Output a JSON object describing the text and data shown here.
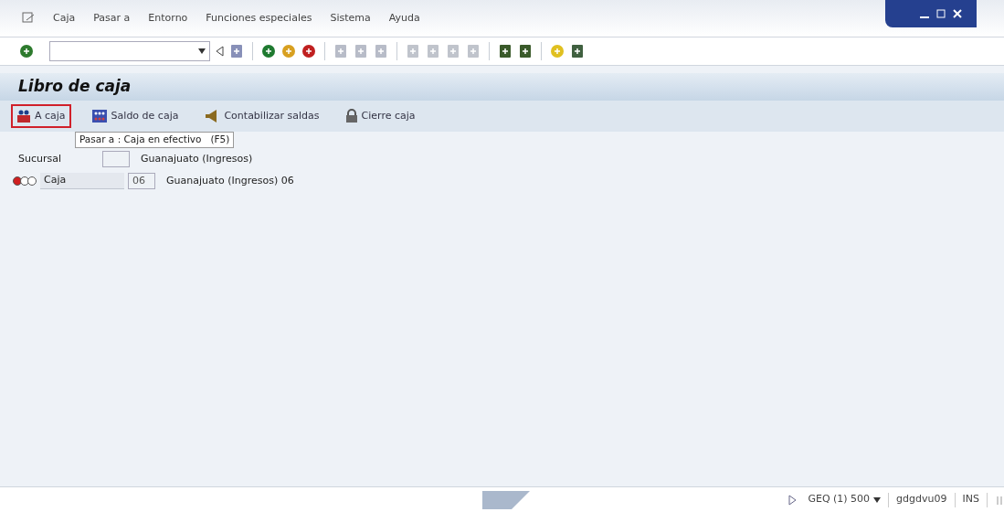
{
  "menu": [
    "Caja",
    "Pasar a",
    "Entorno",
    "Funciones especiales",
    "Sistema",
    "Ayuda"
  ],
  "title": "Libro de caja",
  "app_toolbar": [
    {
      "label": "A caja",
      "selected": true,
      "kind": "people"
    },
    {
      "label": "Saldo de caja",
      "selected": false,
      "kind": "balance"
    },
    {
      "label": "Contabilizar saldas",
      "selected": false,
      "kind": "post"
    },
    {
      "label": "Cierre caja",
      "selected": false,
      "kind": "lock"
    }
  ],
  "tooltip": "Pasar a : Caja en efectivo   (F5)",
  "rows": [
    {
      "kind": "plain",
      "label": "Sucursal",
      "code": "",
      "description": "Guanajuato (Ingresos)"
    },
    {
      "kind": "status",
      "lights": [
        {
          "on": true
        },
        {
          "on": false
        },
        {
          "on": false
        }
      ],
      "label": "Caja",
      "code": "06",
      "description": "Guanajuato (Ingresos) 06"
    }
  ],
  "status_bar": {
    "system": "GEQ (1) 500",
    "server": "gdgdvu09",
    "mode": "INS"
  }
}
